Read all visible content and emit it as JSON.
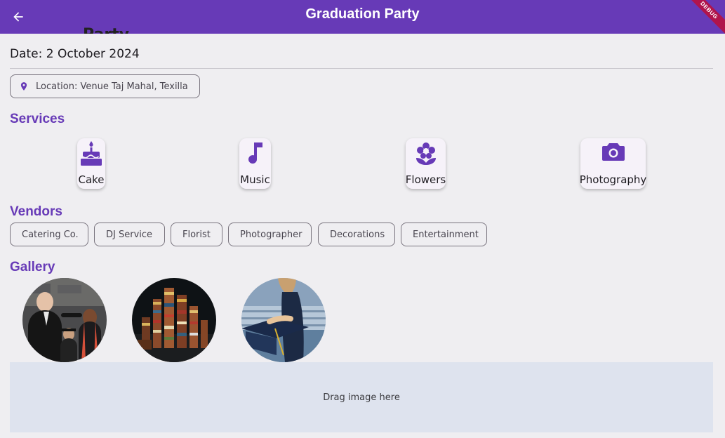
{
  "appbar": {
    "title": "Graduation Party",
    "back_icon": "arrow-back-icon",
    "debug_banner": "DEBUG",
    "color": "#673ab7"
  },
  "event": {
    "clipped_title": "Party",
    "date": "Date: 2 October 2024",
    "location": "Location: Venue Taj Mahal, Texilla"
  },
  "services": {
    "title": "Services",
    "items": [
      {
        "label": "Cake",
        "icon": "cake-icon"
      },
      {
        "label": "Music",
        "icon": "music-note-icon"
      },
      {
        "label": "Flowers",
        "icon": "flower-icon"
      },
      {
        "label": "Photography",
        "icon": "camera-icon"
      }
    ]
  },
  "vendors": {
    "title": "Vendors",
    "items": [
      "Catering Co.",
      "DJ Service",
      "Florist",
      "Photographer",
      "Decorations",
      "Entertainment"
    ]
  },
  "gallery": {
    "title": "Gallery",
    "images": [
      "graduation-ceremony-photo",
      "stacked-books-photo",
      "graduation-cap-photo"
    ]
  },
  "dropzone": {
    "label": "Drag image here"
  }
}
